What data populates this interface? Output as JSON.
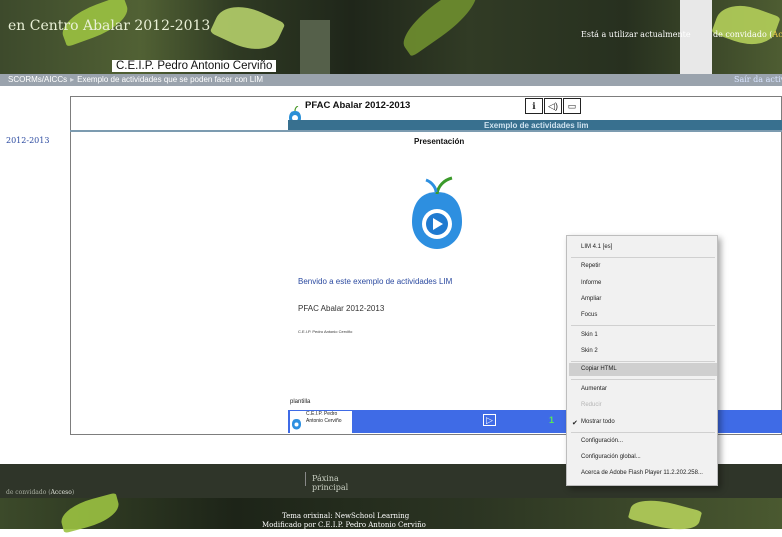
{
  "header": {
    "title": "en Centro Abalar 2012-2013",
    "school": "C.E.I.P. Pedro Antonio Cerviño",
    "user_text": "Está a utilizar actualmente",
    "guest_prefix": "de convidado (",
    "guest_link": "Acce"
  },
  "nav": {
    "crumb_1": "SCORMs/AICCs",
    "crumb_sep": "▸",
    "crumb_2": "Exemplo de actividades que se poden facer con LIM",
    "logout": "Saír da activi"
  },
  "side": {
    "year": "2012-2013"
  },
  "activity": {
    "title": "PFAC Abalar 2012-2013",
    "subtitle": "Exemplo de actividades lim",
    "section": "Presentación",
    "welcome": "Benvido a este exemplo de actividades LIM",
    "pfac": "PFAC Abalar 2012-2013",
    "ceip_small": "C.E.I.P. Pedro Antonio Cerviño",
    "plantilla": "plantilla",
    "bottom_logo_text": "C.E.I.P. Pedro Antonio Cerviño",
    "page_number": "1",
    "play_symbol": "▷"
  },
  "context_menu": {
    "items": [
      {
        "label": "LIM 4.1  [es]",
        "enabled": true
      },
      {
        "label": "Repetir",
        "enabled": true
      },
      {
        "label": "Informe",
        "enabled": true
      },
      {
        "label": "Ampliar",
        "enabled": true
      },
      {
        "label": "Focus",
        "enabled": true
      },
      {
        "label": "Skin 1",
        "enabled": true
      },
      {
        "label": "Skin 2",
        "enabled": true
      },
      {
        "label": "Copiar HTML",
        "enabled": true
      },
      {
        "label": "Aumentar",
        "enabled": true
      },
      {
        "label": "Reducir",
        "enabled": false
      },
      {
        "label": "Mostrar todo",
        "enabled": true,
        "checked": true
      },
      {
        "label": "Configuración...",
        "enabled": true
      },
      {
        "label": "Configuración global...",
        "enabled": true
      },
      {
        "label": "Acerca de Adobe Flash Player 11.2.202.258...",
        "enabled": true
      }
    ],
    "check_symbol": "✔"
  },
  "footer": {
    "home_link": "Páxina principal",
    "guest_prefix": "de convidado (",
    "guest_link": "Acceso",
    "guest_suffix": ")",
    "theme_line1": "Tema orixinal: NewSchool Learning",
    "theme_line2": "Modificado por C.E.I.P. Pedro Antonio Cerviño"
  },
  "colors": {
    "nav_bar": "#9aa3ad",
    "activity_blue_bar": "#38708f",
    "activity_bottom_bar": "#3f6be6",
    "footer": "#2f3529"
  },
  "icons": {
    "toolbar": [
      "info-icon",
      "sound-icon",
      "screen-icon"
    ],
    "logo": "apple-logo-icon"
  }
}
